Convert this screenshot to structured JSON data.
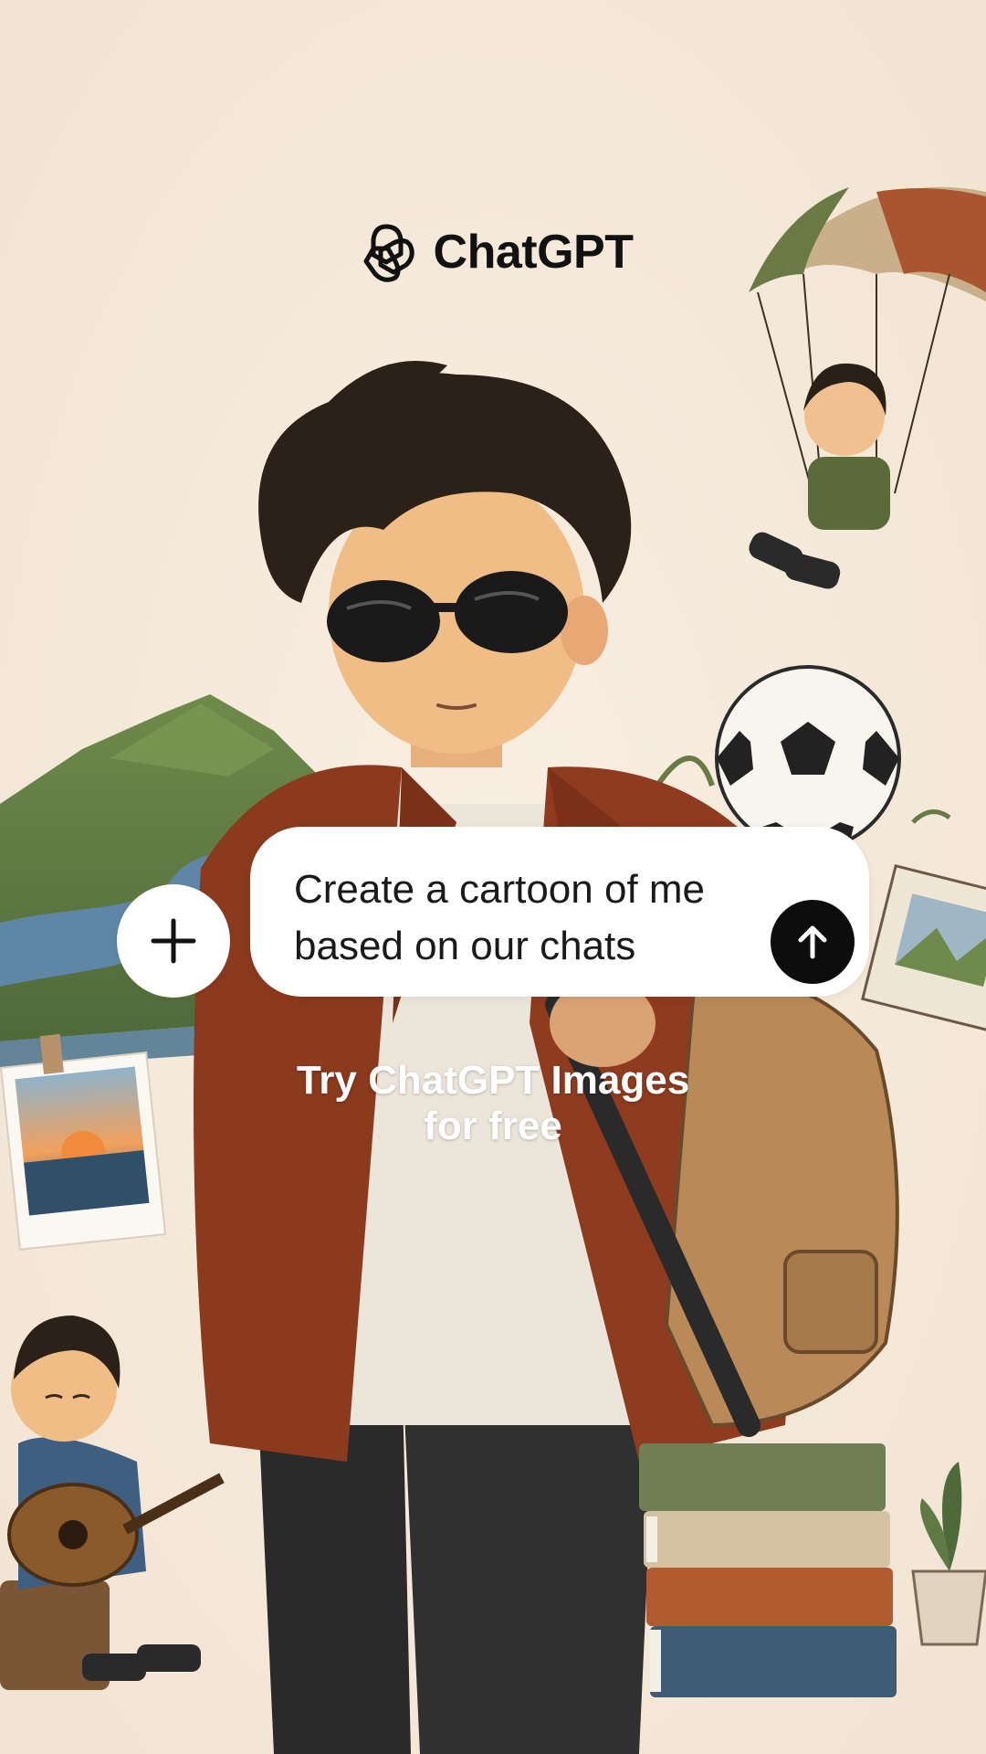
{
  "brand": {
    "name": "ChatGPT",
    "logo_icon": "openai-knot-icon"
  },
  "composer": {
    "prompt_text": "Create a cartoon of me based on our chats",
    "plus_icon": "plus-icon",
    "send_icon": "arrow-up-icon"
  },
  "cta": {
    "line1": "Try ChatGPT Images",
    "line2": "for free"
  },
  "colors": {
    "background": "#f5e9da",
    "jacket": "#8b3a1e",
    "accent_dark": "#0d0d0d",
    "white": "#ffffff"
  },
  "illustration": {
    "elements": [
      "cartoon-boy-sunglasses",
      "parachute-boy",
      "soccer-ball",
      "mountains-river",
      "polaroid-sunset",
      "boy-playing-guitar",
      "stacked-books",
      "sketchbook",
      "potted-plant",
      "backpack"
    ]
  }
}
